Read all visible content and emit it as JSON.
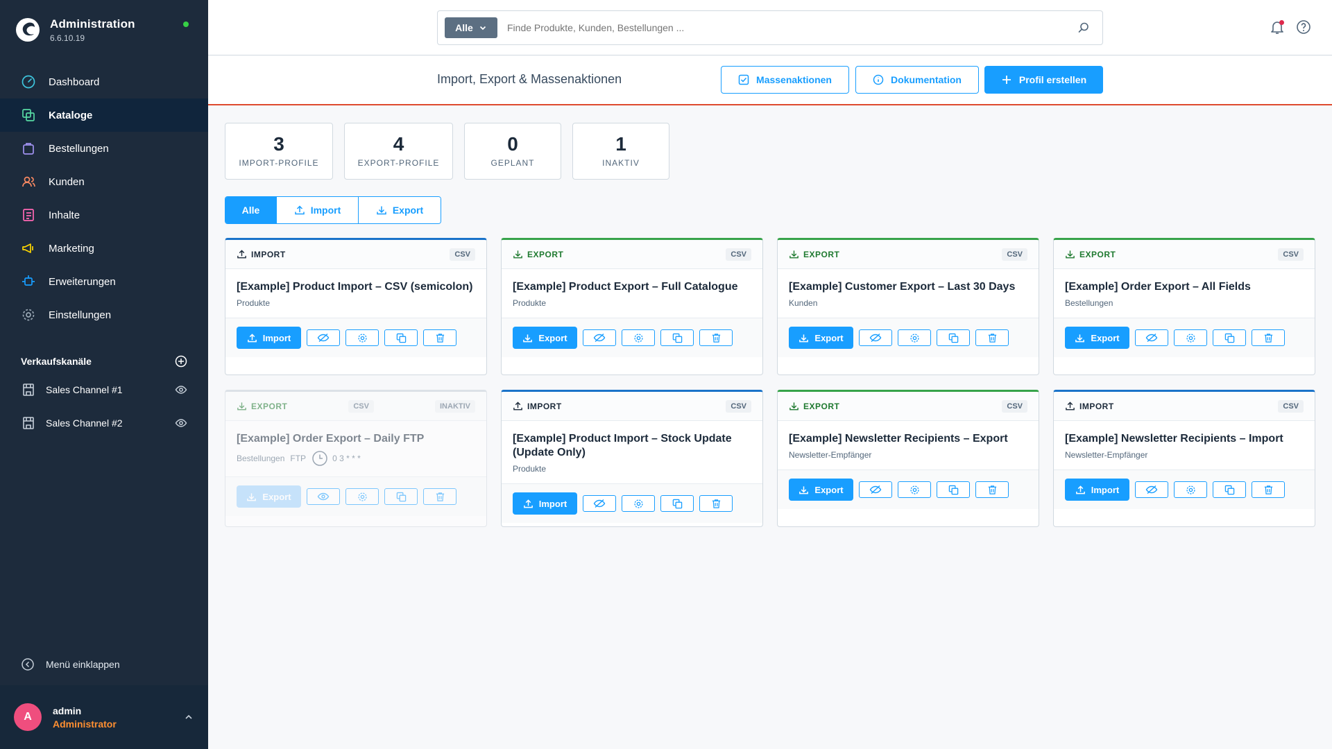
{
  "app": {
    "title": "Administration",
    "version": "6.6.10.19"
  },
  "nav": [
    {
      "label": "Dashboard",
      "icon": "dashboard-icon"
    },
    {
      "label": "Kataloge",
      "icon": "catalog-icon",
      "active": true
    },
    {
      "label": "Bestellungen",
      "icon": "orders-icon"
    },
    {
      "label": "Kunden",
      "icon": "customers-icon"
    },
    {
      "label": "Inhalte",
      "icon": "content-icon"
    },
    {
      "label": "Marketing",
      "icon": "marketing-icon"
    },
    {
      "label": "Erweiterungen",
      "icon": "extensions-icon"
    },
    {
      "label": "Einstellungen",
      "icon": "settings-icon"
    }
  ],
  "sales_channels": {
    "heading": "Verkaufskanäle",
    "items": [
      {
        "label": "Sales Channel #1"
      },
      {
        "label": "Sales Channel #2"
      }
    ]
  },
  "sidebar_footer": {
    "collapse_label": "Menü einklappen",
    "user_initial": "A",
    "user_name": "admin",
    "user_role": "Administrator"
  },
  "search": {
    "scope": "Alle",
    "placeholder": "Finde Produkte, Kunden, Bestellungen ..."
  },
  "page": {
    "title": "Import, Export & Massenaktionen",
    "buttons": {
      "bulk": "Massenaktionen",
      "docs": "Dokumentation",
      "create": "Profil erstellen"
    }
  },
  "stats": [
    {
      "value": "3",
      "label": "IMPORT-PROFILE"
    },
    {
      "value": "4",
      "label": "EXPORT-PROFILE"
    },
    {
      "value": "0",
      "label": "GEPLANT"
    },
    {
      "value": "1",
      "label": "INAKTIV"
    }
  ],
  "filters": [
    {
      "label": "Alle",
      "active": true
    },
    {
      "label": "Import"
    },
    {
      "label": "Export"
    }
  ],
  "cards": [
    {
      "type": "IMPORT",
      "format": "CSV",
      "title": "[Example] Product Import – CSV (semicolon)",
      "entity": "Produkte",
      "action": "Import"
    },
    {
      "type": "EXPORT",
      "format": "CSV",
      "title": "[Example] Product Export – Full Catalogue",
      "entity": "Produkte",
      "action": "Export"
    },
    {
      "type": "EXPORT",
      "format": "CSV",
      "title": "[Example] Customer Export – Last 30 Days",
      "entity": "Kunden",
      "action": "Export"
    },
    {
      "type": "EXPORT",
      "format": "CSV",
      "title": "[Example] Order Export – All Fields",
      "entity": "Bestellungen",
      "action": "Export"
    },
    {
      "type": "EXPORT",
      "format": "CSV",
      "status": "INAKTIV",
      "title": "[Example] Order Export – Daily FTP",
      "entity": "Bestellungen",
      "transport": "FTP",
      "cron": "0 3 * * *",
      "action": "Export"
    },
    {
      "type": "IMPORT",
      "format": "CSV",
      "title": "[Example] Product Import – Stock Update (Update Only)",
      "entity": "Produkte",
      "action": "Import"
    },
    {
      "type": "EXPORT",
      "format": "CSV",
      "title": "[Example] Newsletter Recipients – Export",
      "entity": "Newsletter-Empfänger",
      "action": "Export"
    },
    {
      "type": "IMPORT",
      "format": "CSV",
      "title": "[Example] Newsletter Recipients – Import",
      "entity": "Newsletter-Empfänger",
      "action": "Import"
    }
  ],
  "colors": {
    "sidebar": "#1d2b3c",
    "primary": "#189eff",
    "import_accent": "#1a73c9",
    "export_accent": "#37a34a",
    "header_rule": "#de4a2e",
    "avatar": "#ef4e7e",
    "role": "#ff8f31"
  }
}
